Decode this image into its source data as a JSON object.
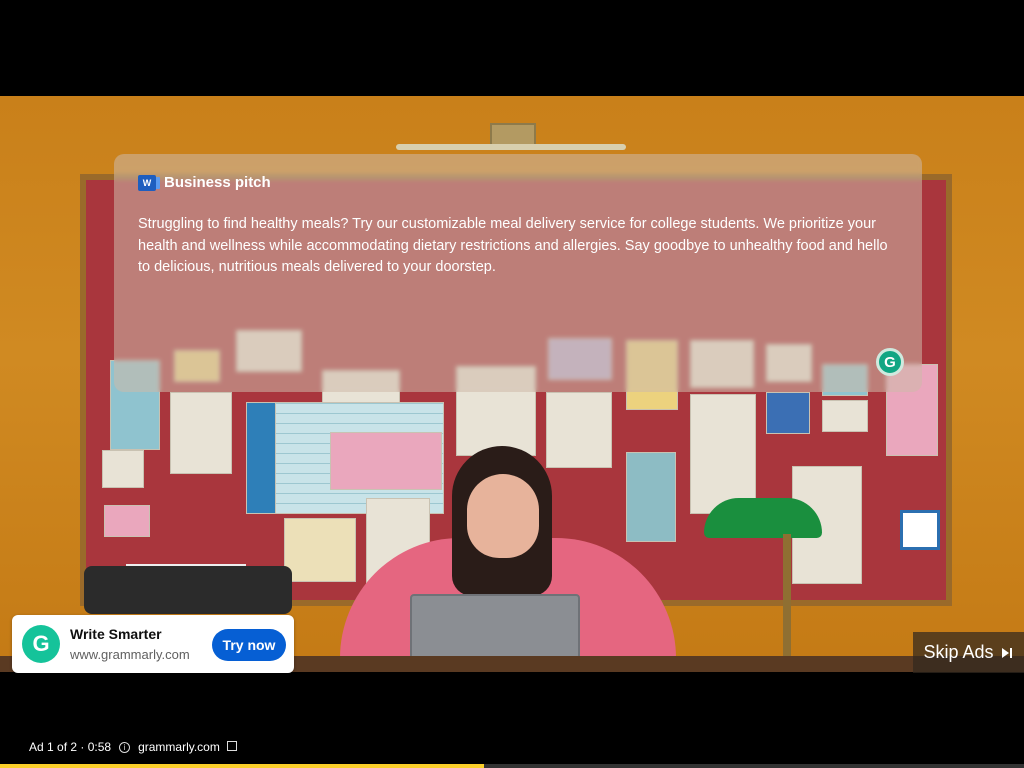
{
  "video": {
    "overlay_card": {
      "title": "Business pitch",
      "body": "Struggling to find healthy meals? Try our customizable meal delivery service for college students. We prioritize your health and wellness while accommodating dietary restrictions and allergies. Say goodbye to unhealthy food and hello to delicious, nutritious meals delivered to your doorstep.",
      "app_icon": "word-icon",
      "badge_letter": "G"
    }
  },
  "ad_card": {
    "logo_letter": "G",
    "title": "Write Smarter",
    "url": "www.grammarly.com",
    "cta_label": "Try now",
    "cta_color": "#065fd4",
    "logo_color": "#15c39a"
  },
  "skip_button": {
    "label": "Skip Ads",
    "icon": "skip-next-icon"
  },
  "ad_info": {
    "position_label": "Ad 1 of 2 · 0:58",
    "info_icon": "info-icon",
    "domain": "grammarly.com",
    "external_icon": "external-link-icon"
  },
  "progress": {
    "fraction": 0.473,
    "color": "#fbcf2a"
  }
}
